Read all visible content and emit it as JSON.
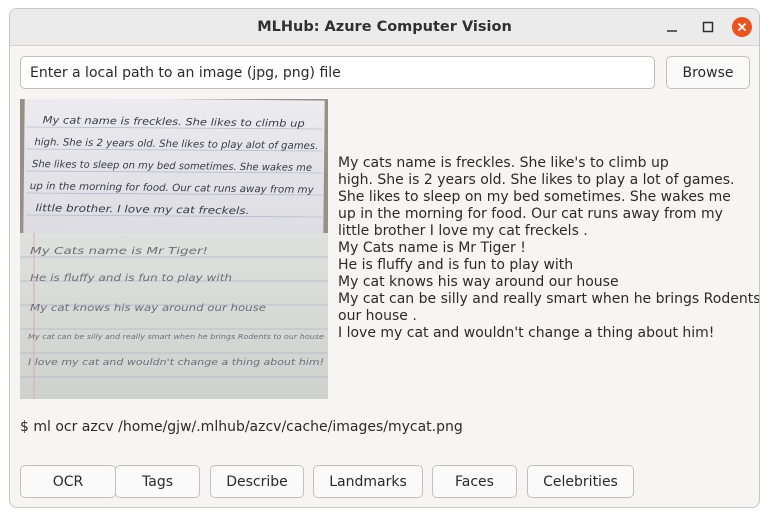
{
  "window": {
    "title": "MLHub: Azure Computer Vision"
  },
  "controls": {
    "minimize_icon": "minimize-icon",
    "maximize_icon": "maximize-icon",
    "close_icon": "close-icon",
    "close_color": "#e95420"
  },
  "path_input": {
    "placeholder": "Enter a local path to an image (jpg, png) file",
    "value": ""
  },
  "browse_label": "Browse",
  "image": {
    "top_note": [
      "My cat name is freckles. She likes to climb up",
      "high. She is 2 years old. She likes to play alot of games.",
      "She likes to sleep on my bed sometimes. She wakes me",
      "up in the morning for food. Our cat runs away from my",
      "little brother. I love my cat freckels."
    ],
    "bottom_note": [
      "My Cats name is Mr Tiger!",
      "He is fluffy and is fun to play with",
      "My cat knows his way around our house",
      "My cat can be silly and really smart when he brings Rodents to our house",
      "I love my cat and wouldn't change a thing about him!"
    ]
  },
  "ocr_lines": [
    "My cats name is freckles. She like's to climb up",
    "high. She is 2 years old. She likes to play a lot of games.",
    "She likes to sleep on my bed sometimes. She wakes me",
    "up in the morning for food. Our cat runs away from my",
    "little brother I love my cat freckels .",
    "My Cats name is Mr Tiger !",
    "He is fluffy and is fun to play with",
    "My cat knows his way around our house",
    "My cat can be silly and really smart when he brings Rodents to",
    "our house .",
    "I love my cat and wouldn't change a thing about him!"
  ],
  "command": "$ ml ocr azcv /home/gjw/.mlhub/azcv/cache/images/mycat.png",
  "buttons": {
    "ocr": "OCR",
    "tags": "Tags",
    "describe": "Describe",
    "landmarks": "Landmarks",
    "faces": "Faces",
    "celebrities": "Celebrities"
  }
}
